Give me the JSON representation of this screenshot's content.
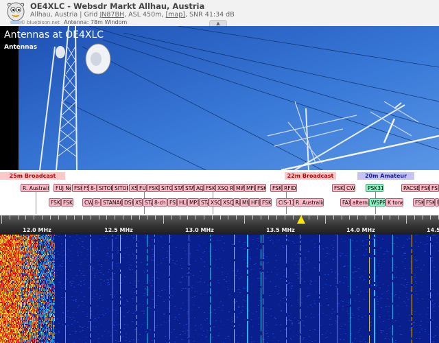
{
  "header": {
    "title": "OE4XLC - Websdr Markt Allhau, Austria",
    "location": "Allhau, Austria | Grid",
    "grid_locator": "JN87BH",
    "asl": ", ASL 450m,",
    "map_link": "[map]",
    "snr": ", SNR 41:34 dB",
    "copyright": "© bluebison.net",
    "antenna": "Antenna: 78m Windom",
    "collapse_glyph": "▲"
  },
  "photo": {
    "title": "Antennas at OE4XLC",
    "subtitle": "Antennas"
  },
  "bands": [
    {
      "label": "25m Broadcast",
      "type": "broadcast"
    },
    {
      "label": "22m Broadcast",
      "type": "broadcast"
    },
    {
      "label": "20m Amateur",
      "type": "amateur"
    }
  ],
  "station_labels_row1": [
    "R. Australia",
    "FUJ Ne",
    "FSK",
    "FSK",
    "8-c",
    "SITOR",
    "SITOR",
    "XS",
    "FUJ",
    "FSK",
    "SITO",
    "STA",
    "STA",
    "AQI",
    "FSK",
    "XSQ Ra",
    "MW",
    "MFD",
    "FSK",
    "FSK",
    "RFID",
    "FSK",
    "CW",
    "PSK31",
    "PACSE",
    "FSK",
    "FSK"
  ],
  "station_labels_row2": [
    "FSK",
    "FSK",
    "CW",
    "8-c",
    "STANAG",
    "DSC",
    "XSC",
    "STA",
    "8-ch",
    "FSK",
    "HLI",
    "MPX",
    "STA",
    "XSQ",
    "XSQ",
    "Ra",
    "MW",
    "HFD",
    "FSK",
    "CIS-12",
    "R. Australia",
    "FAX",
    "alterna",
    "WSPR",
    "K tones",
    "FSK",
    "FSK",
    "FSK"
  ],
  "scale": {
    "labels": [
      "12.0 MHz",
      "12.5 MHz",
      "13.0 MHz",
      "13.5 MHz",
      "14.0 MHz",
      "14.5"
    ],
    "cursor_color": "#ffe800"
  },
  "colors": {
    "broadcast_band_bg": "#ffc8c8",
    "broadcast_band_text": "#c00000",
    "amateur_band_bg": "#c4c4f4",
    "station_label_bg": "#ffbcc8",
    "digital_label_bg": "#8ef2c2",
    "waterfall_bg": "#0a1f8e"
  }
}
